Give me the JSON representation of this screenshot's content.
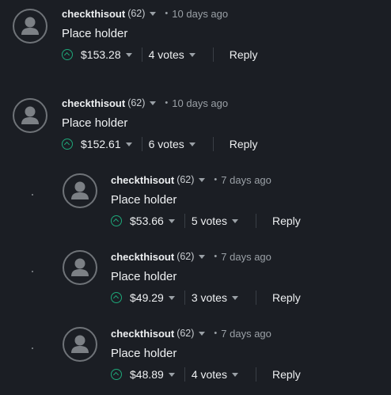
{
  "comments": [
    {
      "author": "checkthisout",
      "reputation": "(62)",
      "dot": "•",
      "time": "10 days ago",
      "text": "Place holder",
      "payout": "$153.28",
      "votes": "4 votes",
      "reply": "Reply"
    },
    {
      "author": "checkthisout",
      "reputation": "(62)",
      "dot": "•",
      "time": "10 days ago",
      "text": "Place holder",
      "payout": "$152.61",
      "votes": "6 votes",
      "reply": "Reply"
    },
    {
      "author": "checkthisout",
      "reputation": "(62)",
      "dot": "•",
      "time": "7 days ago",
      "text": "Place holder",
      "payout": "$53.66",
      "votes": "5 votes",
      "reply": "Reply"
    },
    {
      "author": "checkthisout",
      "reputation": "(62)",
      "dot": "•",
      "time": "7 days ago",
      "text": "Place holder",
      "payout": "$49.29",
      "votes": "3 votes",
      "reply": "Reply"
    },
    {
      "author": "checkthisout",
      "reputation": "(62)",
      "dot": "•",
      "time": "7 days ago",
      "text": "Place holder",
      "payout": "$48.89",
      "votes": "4 votes",
      "reply": "Reply"
    }
  ],
  "colors": {
    "background": "#1b1e24",
    "upvote": "#1ea87a",
    "muted": "#9aa0a6"
  }
}
